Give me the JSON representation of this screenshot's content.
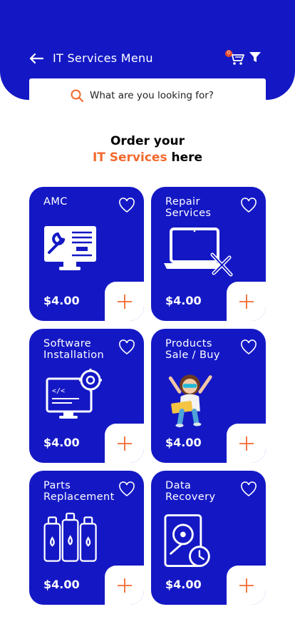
{
  "header": {
    "title": "IT Services Menu",
    "back_icon": "arrow-left-icon",
    "cart_icon": "cart-icon",
    "cart_count": "0",
    "filter_icon": "filter-icon",
    "background_color": "#1418c4"
  },
  "search": {
    "placeholder": "What are you looking for?",
    "value": "",
    "icon": "search-icon",
    "icon_color": "#f26a2e"
  },
  "intro": {
    "line1": "Order your",
    "line2_accent": "IT Services",
    "line2_rest": " here",
    "accent_color": "#f26a2e"
  },
  "services": [
    {
      "title": "AMC",
      "price": "$4.00",
      "illustration": "monitor-wrench-icon"
    },
    {
      "title": "Repair\nServices",
      "price": "$4.00",
      "illustration": "laptop-tools-icon"
    },
    {
      "title": "Software\nInstallation",
      "price": "$4.00",
      "illustration": "monitor-gear-code-icon"
    },
    {
      "title": "Products\nSale / Buy",
      "price": "$4.00",
      "illustration": "girl-with-laptop-illustration"
    },
    {
      "title": "Parts\nReplacement",
      "price": "$4.00",
      "illustration": "ink-bottles-icon"
    },
    {
      "title": "Data\nRecovery",
      "price": "$4.00",
      "illustration": "hard-drive-clock-icon"
    }
  ],
  "card_actions": {
    "favorite_icon": "heart-outline-icon",
    "add_icon": "plus-icon"
  }
}
